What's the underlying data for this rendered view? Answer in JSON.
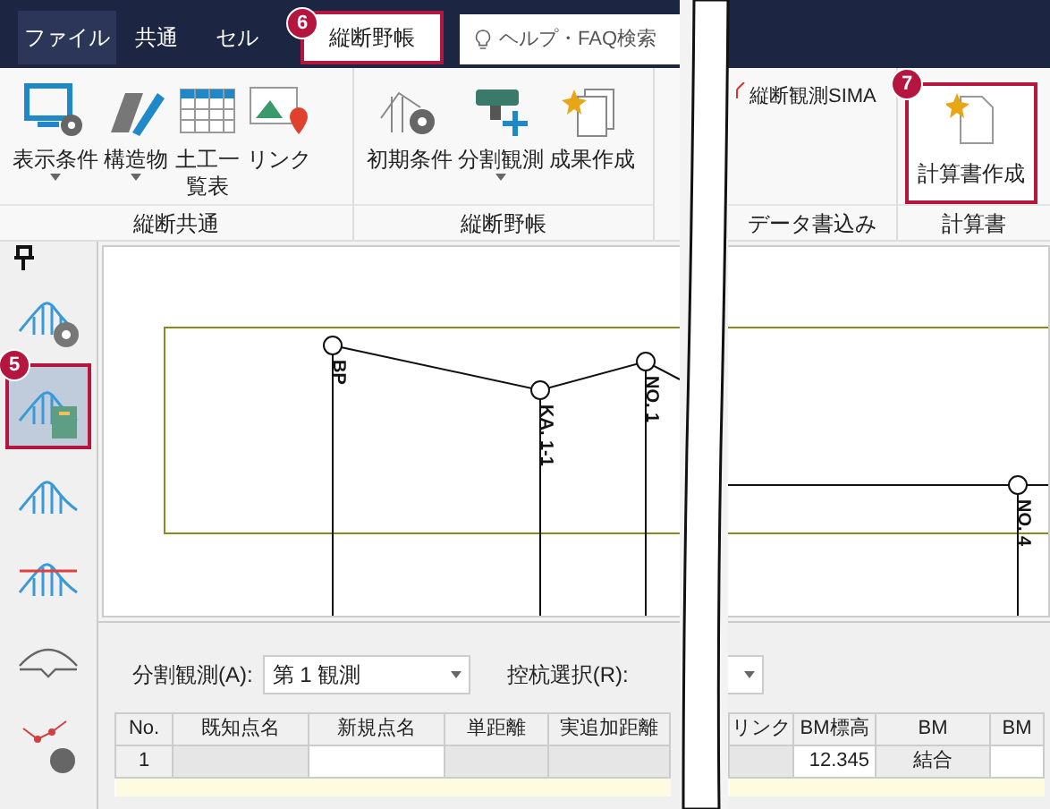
{
  "tabs": [
    {
      "label": "ファイル",
      "selected": false,
      "kind": "file"
    },
    {
      "label": "共通",
      "selected": false,
      "kind": "tab"
    },
    {
      "label": "セル",
      "selected": false,
      "kind": "tab"
    },
    {
      "label": "縦断野帳",
      "selected": true,
      "kind": "tab",
      "badge": "6"
    }
  ],
  "search": {
    "placeholder": "ヘルプ・FAQ検索"
  },
  "ribbon_left": [
    {
      "label": "縦断共通",
      "buttons": [
        {
          "label": "表示条件",
          "dropdown": true
        },
        {
          "label": "構造物",
          "dropdown": true
        },
        {
          "label": "土工一覧表",
          "dropdown": false
        },
        {
          "label": "リンク",
          "dropdown": false
        }
      ]
    },
    {
      "label": "縦断野帳",
      "buttons": [
        {
          "label": "初期条件",
          "dropdown": false
        },
        {
          "label": "分割観測",
          "dropdown": true
        },
        {
          "label": "成果作成",
          "dropdown": false
        }
      ]
    }
  ],
  "ribbon_right": [
    {
      "label": "データ書込み",
      "small_button": "縦断観測SIMA"
    },
    {
      "label": "計算書",
      "button": "計算書作成",
      "badge": "7"
    }
  ],
  "sidebar": [
    {
      "selected": false
    },
    {
      "selected": true,
      "badge": "5"
    },
    {
      "selected": false
    },
    {
      "selected": false
    },
    {
      "selected": false
    },
    {
      "selected": false
    }
  ],
  "profile_points": [
    "BP",
    "KA. 1-1",
    "NO. 1",
    "NO. 4"
  ],
  "controls": [
    {
      "label": "分割観測(A):",
      "value": "第 1 観測"
    },
    {
      "label": "控杭選択(R):"
    }
  ],
  "table": {
    "columns": [
      "No.",
      "既知点名",
      "新規点名",
      "単距離",
      "実追加距離",
      "リンク",
      "BM標高",
      "BM",
      "BM"
    ],
    "rows": [
      [
        "1",
        "",
        "",
        "",
        "",
        "",
        "12.345",
        "結合",
        ""
      ]
    ]
  }
}
